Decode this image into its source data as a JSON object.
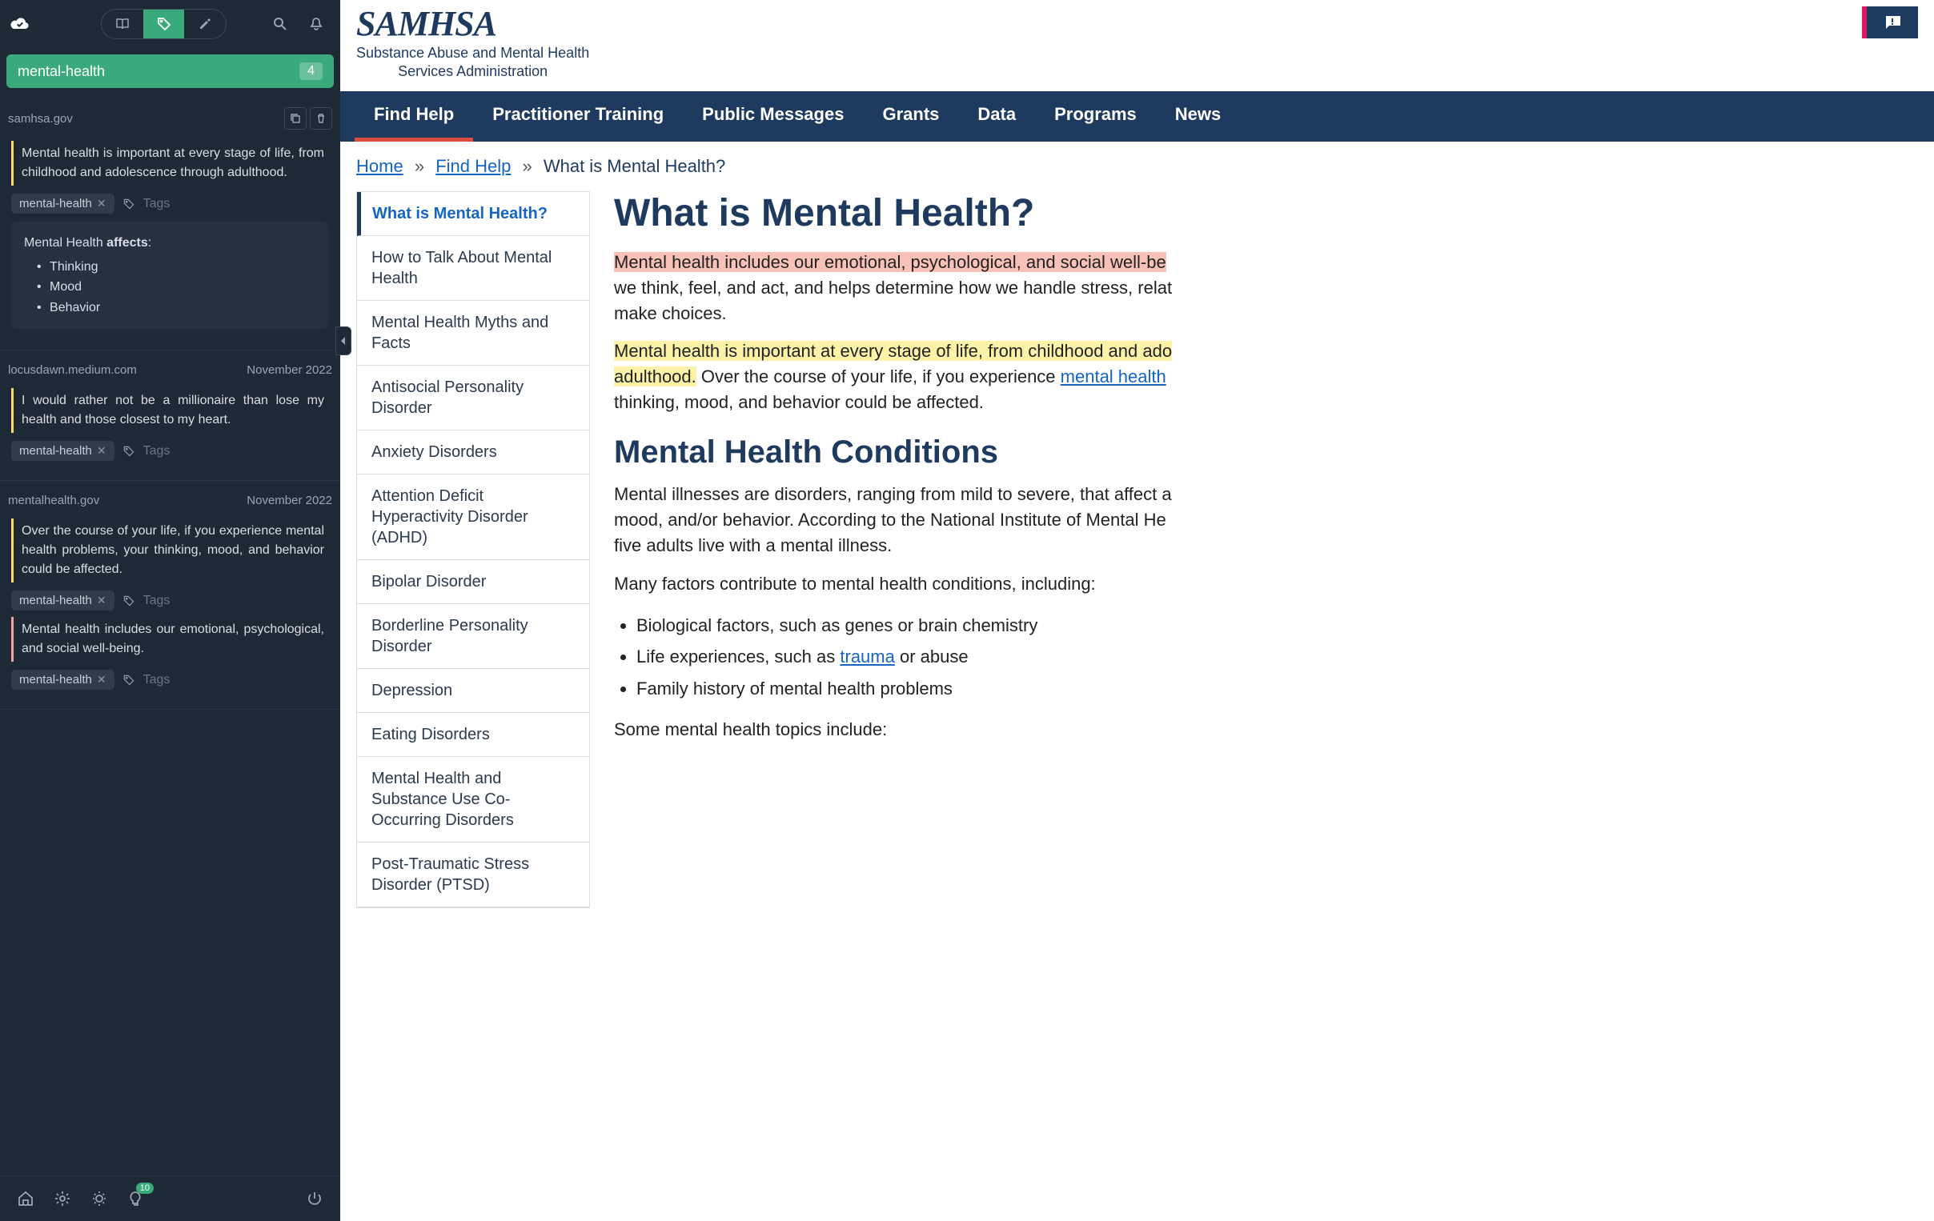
{
  "sidebar": {
    "filter_tag": "mental-health",
    "filter_count": "4",
    "tags_placeholder": "Tags",
    "groups": [
      {
        "source": "samhsa.gov",
        "date": "",
        "items": [
          {
            "quote": "Mental health is important at every stage of life, from childhood and adolescence through adulthood.",
            "tag": "mental-health",
            "border": "yellow"
          }
        ],
        "note": {
          "prefix": "Mental Health ",
          "bold": "affects",
          "suffix": ":",
          "bullets": [
            "Thinking",
            "Mood",
            "Behavior"
          ]
        }
      },
      {
        "source": "locusdawn.medium.com",
        "date": "November 2022",
        "items": [
          {
            "quote": "I would rather not be a millionaire than lose my health and those closest to my heart.",
            "tag": "mental-health",
            "border": "yellow"
          }
        ]
      },
      {
        "source": "mentalhealth.gov",
        "date": "November 2022",
        "items": [
          {
            "quote": "Over the course of your life, if you experience mental health problems, your thinking, mood, and behavior could be affected.",
            "tag": "mental-health",
            "border": "yellow"
          },
          {
            "quote": "Mental health includes our emotional, psychological, and social well-being.",
            "tag": "mental-health",
            "border": "pink"
          }
        ]
      }
    ],
    "badge": "10"
  },
  "page": {
    "logo": "SAMHSA",
    "logo_sub1": "Substance Abuse and Mental Health",
    "logo_sub2": "Services Administration",
    "nav": [
      "Find Help",
      "Practitioner Training",
      "Public Messages",
      "Grants",
      "Data",
      "Programs",
      "News"
    ],
    "breadcrumb": {
      "home": "Home",
      "section": "Find Help",
      "current": "What is Mental Health?"
    },
    "sidemenu": [
      "What is Mental Health?",
      "How to Talk About Mental Health",
      "Mental Health Myths and Facts",
      "Antisocial Personality Disorder",
      "Anxiety Disorders",
      "Attention Deficit Hyperactivity Disorder (ADHD)",
      "Bipolar Disorder",
      "Borderline Personality Disorder",
      "Depression",
      "Eating Disorders",
      "Mental Health and Substance Use Co-Occurring Disorders",
      "Post-Traumatic Stress Disorder (PTSD)"
    ],
    "article": {
      "h1": "What is Mental Health?",
      "p1_hl": "Mental health includes our emotional, psychological, and social well-be",
      "p1_rest": "we think, feel, and act, and helps determine how we handle stress, relat",
      "p1_end": "make choices.",
      "p2_hl": "Mental health is important at every stage of life, from childhood and ado",
      "p2_hl2": "adulthood.",
      "p2_mid": " Over the course of your life, if you experience ",
      "p2_link": "mental health ",
      "p2_end": "thinking, mood, and behavior could be affected.",
      "h2": "Mental Health Conditions",
      "p3a": "Mental illnesses are disorders, ranging from mild to severe, that affect a ",
      "p3b": "mood, and/or behavior. According to the National Institute of Mental He",
      "p3c": "five adults live with a mental illness.",
      "p4": "Many factors contribute to mental health conditions, including:",
      "bullets": [
        {
          "pre": "Biological factors, such as genes or brain chemistry",
          "link": "",
          "post": ""
        },
        {
          "pre": "Life experiences, such as ",
          "link": "trauma",
          "post": " or abuse"
        },
        {
          "pre": "Family history of mental health problems",
          "link": "",
          "post": ""
        }
      ],
      "p5": "Some mental health topics include:"
    }
  }
}
